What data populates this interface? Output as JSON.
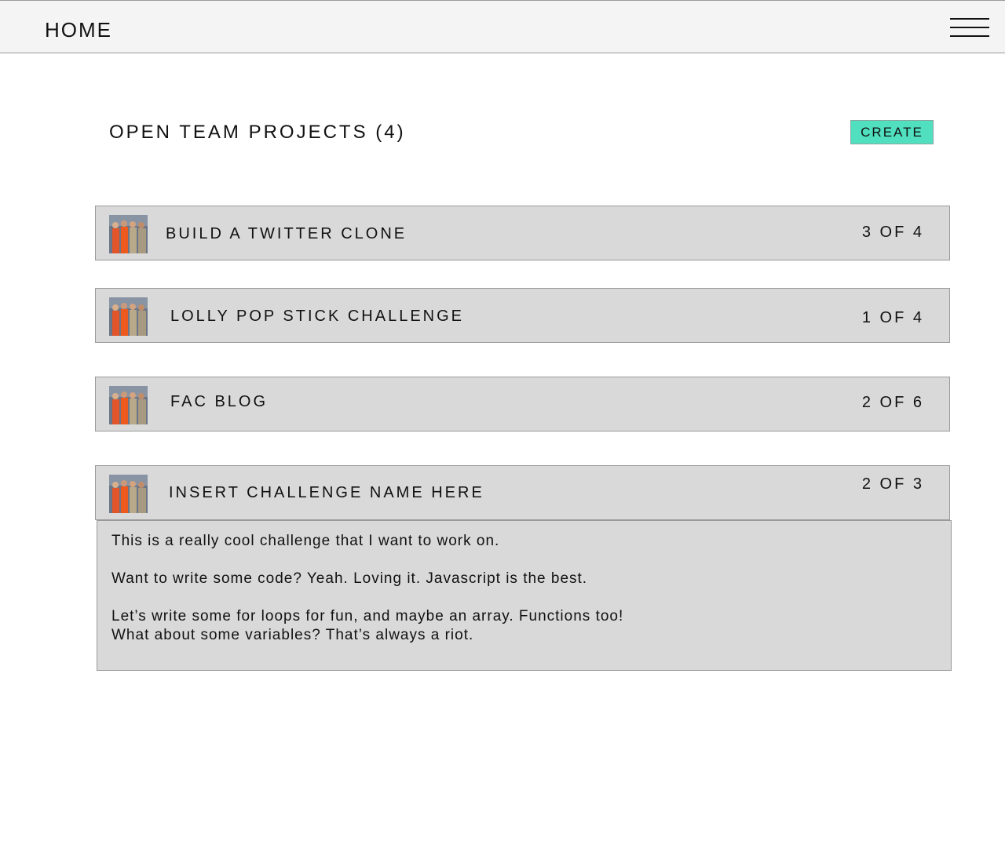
{
  "header": {
    "home_label": "HOME",
    "menu_icon": "hamburger-menu-icon"
  },
  "main": {
    "title": "OPEN TEAM PROJECTS (4)",
    "create_label": "CREATE",
    "create_color": "#50e0c0"
  },
  "projects": [
    {
      "name": "BUILD A TWITTER CLONE",
      "count": "3 OF 4",
      "thumbnail": "team-photo"
    },
    {
      "name": "LOLLY POP STICK CHALLENGE",
      "count": "1 OF 4",
      "thumbnail": "team-photo"
    },
    {
      "name": "FAC BLOG",
      "count": "2 OF 6",
      "thumbnail": "team-photo"
    },
    {
      "name": "INSERT CHALLENGE NAME HERE",
      "count": "2 OF 3",
      "thumbnail": "team-photo"
    }
  ],
  "details": {
    "line1": "This is a really cool challenge that I want to work on.",
    "line2": "Want to write some code? Yeah. Loving it. Javascript is the best.",
    "line3": "Let’s write some for loops for fun, and maybe an array. Functions too!",
    "line4": "What about some variables? That’s always a riot."
  }
}
